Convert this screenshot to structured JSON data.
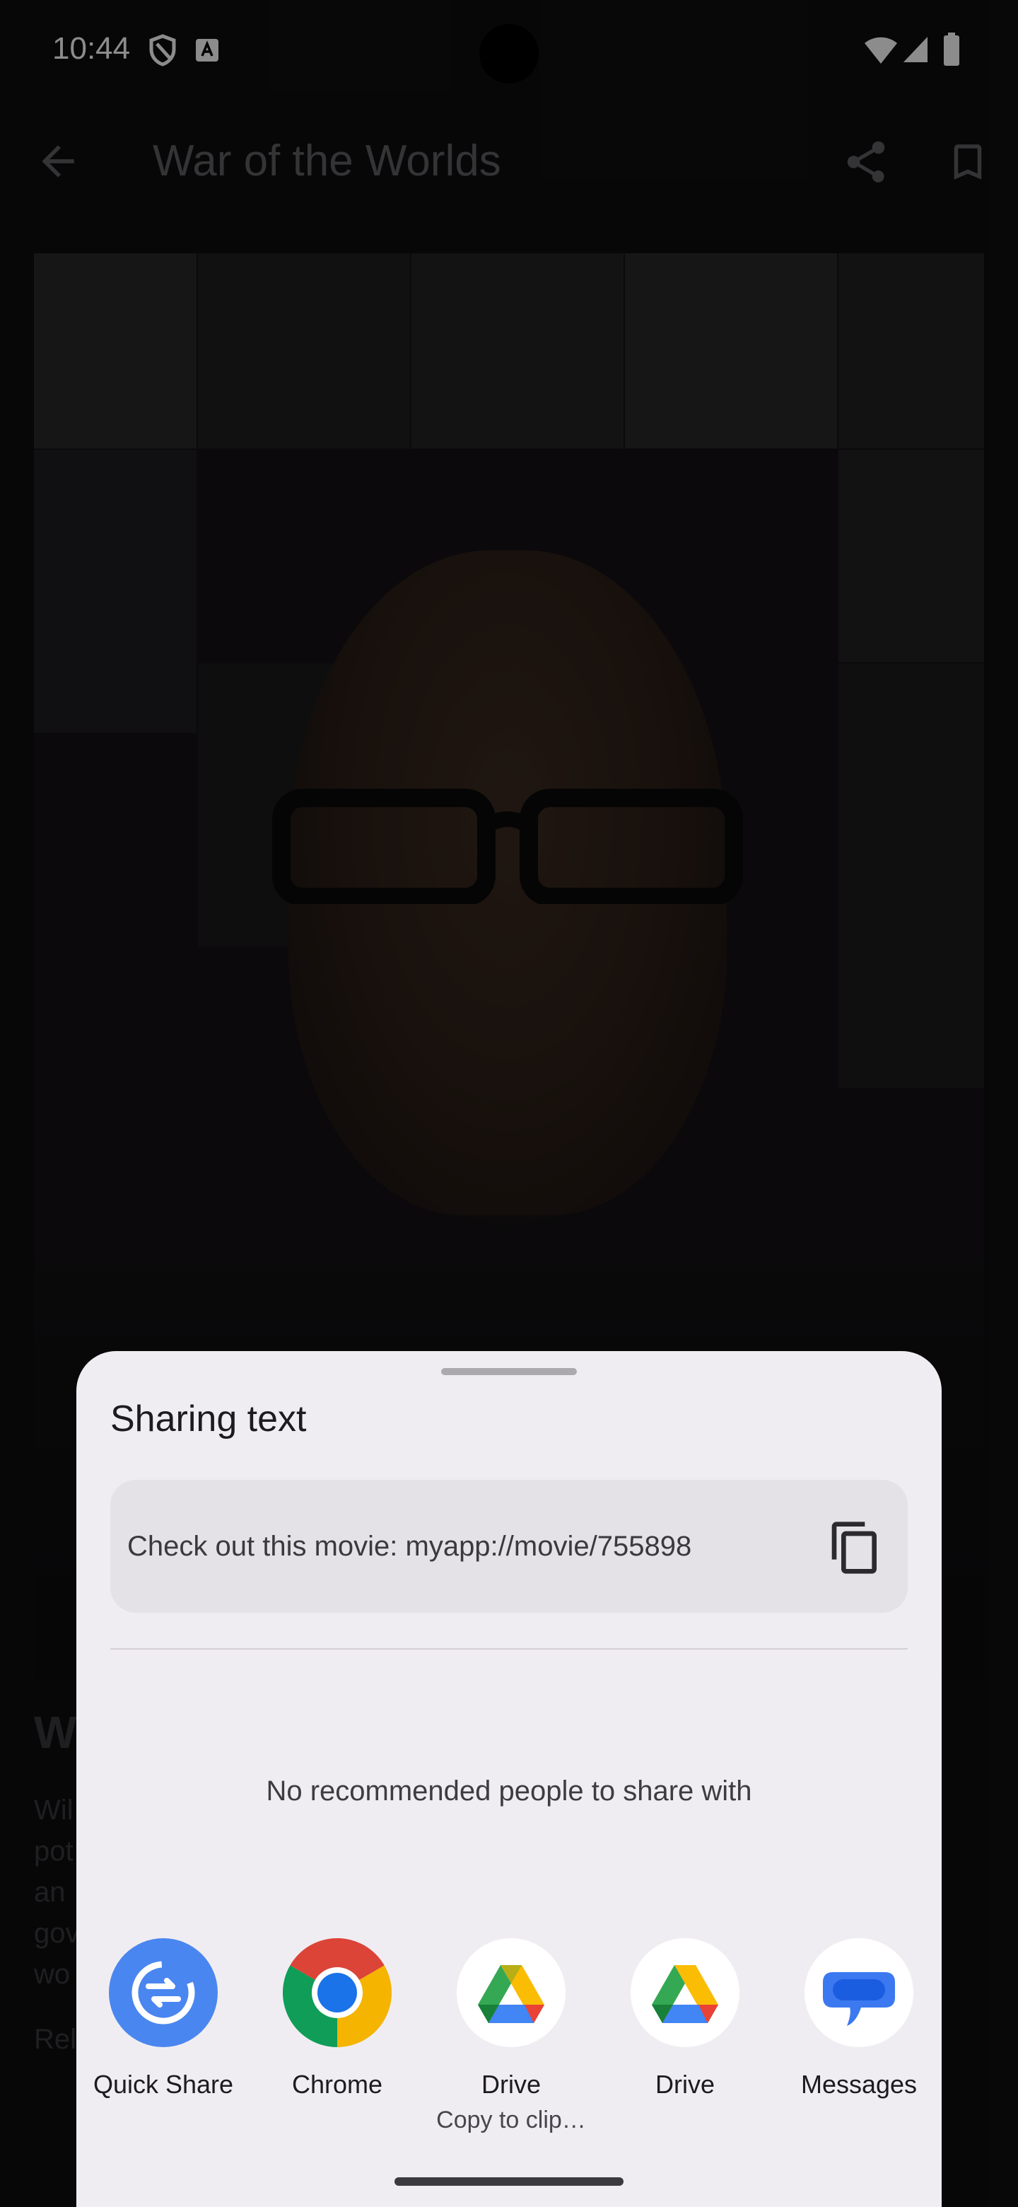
{
  "status_bar": {
    "time": "10:44",
    "icons": [
      "shield-icon",
      "a11y-badge-icon",
      "wifi-icon",
      "signal-icon",
      "battery-icon"
    ]
  },
  "app_bar": {
    "title": "War of the Worlds",
    "back_icon": "arrow-back-icon",
    "share_icon": "share-icon",
    "bookmark_icon": "bookmark-icon"
  },
  "background": {
    "movie_title_partial": "W",
    "overview_lines": [
      "Wil",
      "pot",
      "an",
      "gov",
      "wo"
    ],
    "release_partial": "Rel"
  },
  "share_sheet": {
    "title": "Sharing text",
    "shared_text": "Check out this movie: myapp://movie/755898",
    "copy_icon": "copy-icon",
    "no_recommendations": "No recommended people to share with",
    "targets": [
      {
        "label": "Quick Share",
        "sublabel": "",
        "icon": "quick-share-icon"
      },
      {
        "label": "Chrome",
        "sublabel": "",
        "icon": "chrome-icon"
      },
      {
        "label": "Drive",
        "sublabel": "Copy to clip…",
        "icon": "drive-icon"
      },
      {
        "label": "Drive",
        "sublabel": "",
        "icon": "drive-icon"
      },
      {
        "label": "Messages",
        "sublabel": "",
        "icon": "messages-icon"
      }
    ]
  },
  "colors": {
    "sheet_bg": "#f0edf2",
    "card_bg": "#e5e2e7",
    "quick_share_blue": "#4a86f0",
    "messages_blue": "#3c79f0"
  }
}
